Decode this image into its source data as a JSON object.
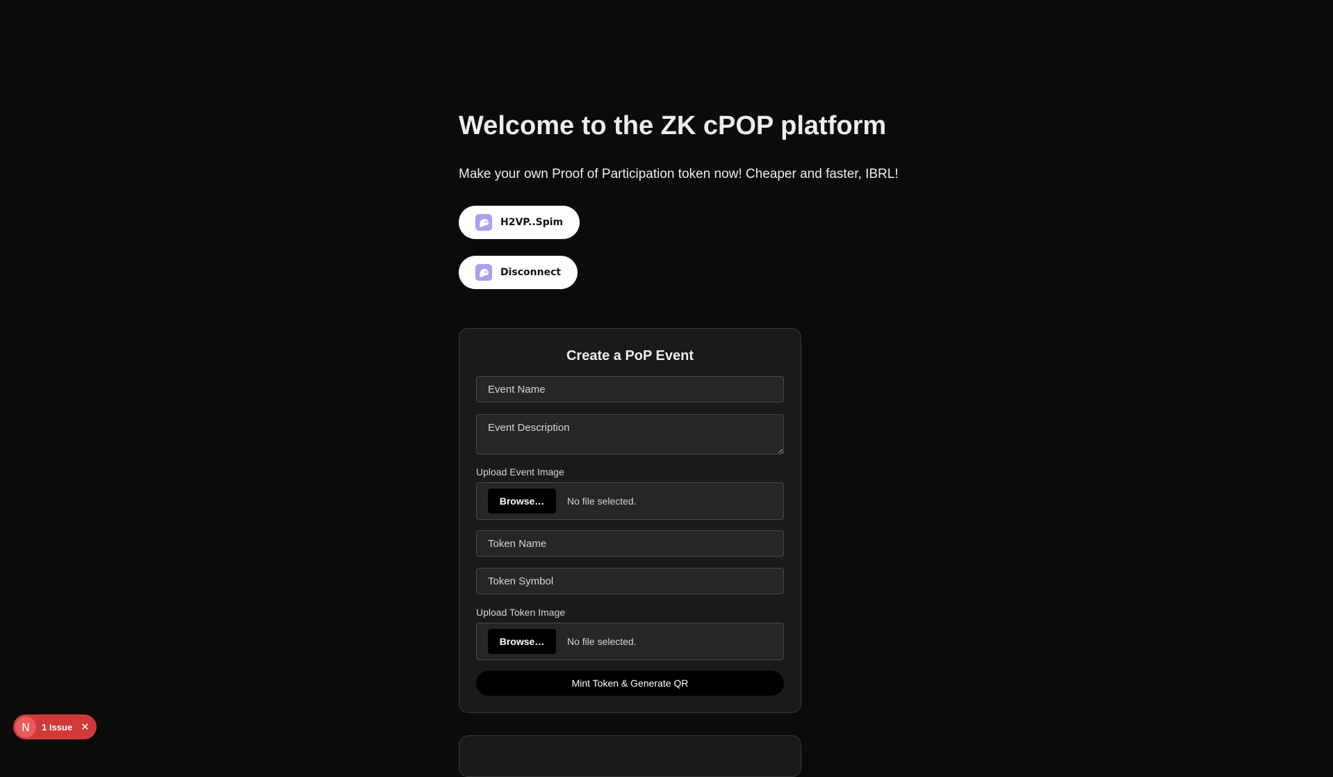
{
  "header": {
    "title": "Welcome to the ZK cPOP platform",
    "subtitle": "Make your own Proof of Participation token now! Cheaper and faster, IBRL!"
  },
  "wallet": {
    "address_label": "H2VP..Spim",
    "disconnect_label": "Disconnect",
    "icon": "phantom-ghost-icon",
    "accent_color": "#ab9ff2"
  },
  "form": {
    "title": "Create a PoP Event",
    "event_name_placeholder": "Event Name",
    "event_description_placeholder": "Event Description",
    "event_image_label": "Upload Event Image",
    "event_image_browse": "Browse…",
    "event_image_status": "No file selected.",
    "token_name_placeholder": "Token Name",
    "token_symbol_placeholder": "Token Symbol",
    "token_image_label": "Upload Token Image",
    "token_image_browse": "Browse…",
    "token_image_status": "No file selected.",
    "submit_label": "Mint Token & Generate QR"
  },
  "dev_overlay": {
    "badge_letter": "N",
    "issues_label": "1 Issue",
    "close_icon": "close-icon",
    "color": "#d13a3a"
  }
}
